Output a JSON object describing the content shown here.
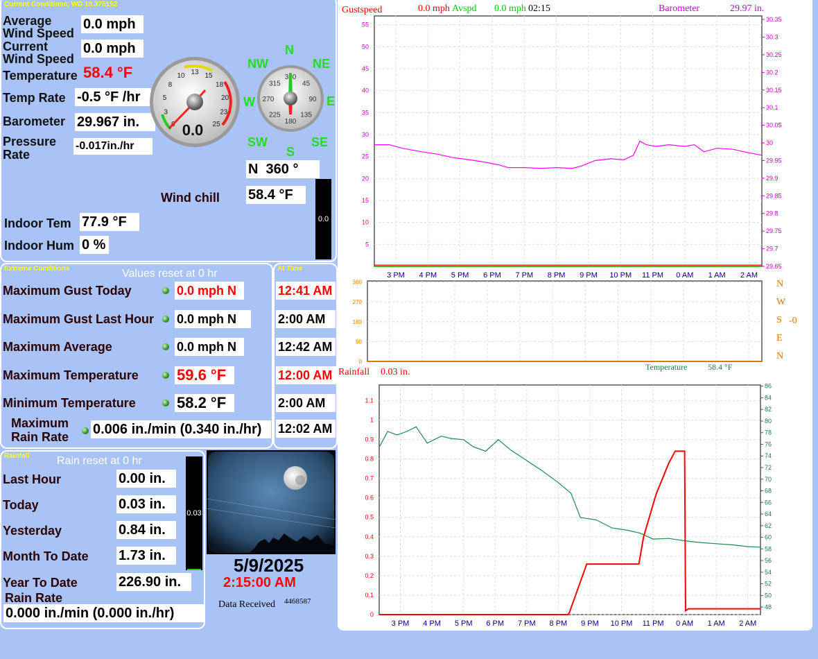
{
  "current": {
    "title": "Current Conditions, WD 10.375152",
    "avg_wind_label_1": "Average",
    "avg_wind_label_2": "Wind Speed",
    "avg_wind": "0.0 mph",
    "cur_wind_label_1": "Current",
    "cur_wind_label_2": "Wind Speed",
    "cur_wind": "0.0 mph",
    "temp_label": "Temperature",
    "temp": "58.4 °F",
    "temp_rate_label": "Temp Rate",
    "temp_rate": "-0.5 °F /hr",
    "baro_label": "Barometer",
    "baro": "29.967 in.",
    "press_rate_label_1": "Pressure",
    "press_rate_label_2": "Rate",
    "press_rate": "-0.017in./hr",
    "wind_chill_label": "Wind chill",
    "wind_chill": "58.4 °F",
    "indoor_temp_label": "Indoor Tem",
    "indoor_temp": "77.9 °F",
    "indoor_hum_label": "Indoor Hum",
    "indoor_hum": "0 %",
    "speed_gauge_value": "0.0",
    "speed_gauge_ticks": [
      "0",
      "3",
      "5",
      "8",
      "10",
      "13",
      "15",
      "18",
      "20",
      "23",
      "25"
    ],
    "dir_gauge_ticks": [
      "360",
      "45",
      "90",
      "135",
      "180",
      "225",
      "270",
      "315"
    ],
    "compass": {
      "n": "N",
      "ne": "NE",
      "e": "E",
      "se": "SE",
      "s": "S",
      "sw": "SW",
      "w": "W",
      "nw": "NW"
    },
    "wind_dir": "N  360 °",
    "side_bar_value": "0.0"
  },
  "extreme": {
    "title": "Extreme Conditions",
    "reset_note": "Values reset at 0 hr",
    "at_time_title": "At Time",
    "rows": [
      {
        "label": "Maximum Gust Today",
        "value": "0.0 mph N",
        "time": "12:41 AM"
      },
      {
        "label": "Maximum Gust Last Hour",
        "value": "0.0 mph  N",
        "time": "2:00 AM"
      },
      {
        "label": "Maximum Average",
        "value": "0.0 mph N",
        "time": "12:42 AM"
      },
      {
        "label": "Maximum Temperature",
        "value": "59.6 °F",
        "time": "12:00 AM"
      },
      {
        "label": "Minimum Temperature",
        "value": "58.2 °F",
        "time": "2:00 AM"
      }
    ],
    "rain_rate_label_1": "Maximum",
    "rain_rate_label_2": "Rain Rate",
    "rain_rate_value": "0.006 in./min (0.340 in./hr)",
    "rain_rate_time": "12:02 AM"
  },
  "rainfall": {
    "title": "Rainfall",
    "reset_note": "Rain reset at 0 hr",
    "rows": [
      {
        "label": "Last Hour",
        "value": "0.00 in."
      },
      {
        "label": "Today",
        "value": "0.03 in."
      },
      {
        "label": "Yesterday",
        "value": "0.84 in."
      },
      {
        "label": "Month To Date",
        "value": "1.73 in."
      },
      {
        "label": "Year To Date",
        "value": "226.90 in."
      }
    ],
    "rain_rate_label": "Rain Rate",
    "rain_rate": "0.000 in./min (0.000 in./hr)",
    "bar_value": "0.03"
  },
  "webcam": {
    "date": "5/9/2025",
    "time": "2:15:00 AM",
    "received_label": "Data Received",
    "received_count": "4468587"
  },
  "colors": {
    "bg": "#a9c3f7",
    "gust": "#ff0000",
    "avg": "#00cc00",
    "baro": "#ff00ff",
    "temp": "#1e8a4c",
    "rain": "#ff0000",
    "dir_axis": "#e07800"
  },
  "chart_data": [
    {
      "type": "line",
      "title": "",
      "legend": {
        "gust_label": "Gustspeed",
        "gust_value": "0.0 mph",
        "avg_label": "Avspd",
        "avg_value": "0.0 mph",
        "time": "02:15",
        "baro_label": "Barometer",
        "baro_value": "29.97 in."
      },
      "x": [
        "3 PM",
        "4 PM",
        "5 PM",
        "6 PM",
        "7 PM",
        "8 PM",
        "9 PM",
        "10 PM",
        "11 PM",
        "0 AM",
        "1 AM",
        "2 AM"
      ],
      "y_left_ticks": [
        5,
        10,
        15,
        20,
        25,
        30,
        35,
        40,
        45,
        50,
        55
      ],
      "y_left_range": [
        0,
        57
      ],
      "y_right_ticks": [
        "29.65",
        "29.7",
        "29.75",
        "29.8",
        "29.85",
        "29.9",
        "29.95",
        "30",
        "30.05",
        "30.1",
        "30.15",
        "30.2",
        "30.25",
        "30.3",
        "30.35"
      ],
      "y_right_range": [
        29.65,
        30.36
      ],
      "x_range": [
        2.33,
        14.4
      ],
      "series": [
        {
          "name": "Gustspeed",
          "axis": "left",
          "points": [
            [
              2.33,
              0.3
            ],
            [
              14.4,
              0.3
            ]
          ]
        },
        {
          "name": "Avspd",
          "axis": "left",
          "points": [
            [
              2.33,
              0
            ],
            [
              14.4,
              0
            ]
          ]
        },
        {
          "name": "Barometer",
          "axis": "right",
          "points": [
            [
              2.33,
              29.995
            ],
            [
              2.8,
              29.995
            ],
            [
              3.2,
              29.985
            ],
            [
              3.8,
              29.975
            ],
            [
              4.3,
              29.968
            ],
            [
              4.8,
              29.958
            ],
            [
              5.3,
              29.952
            ],
            [
              5.8,
              29.945
            ],
            [
              6.2,
              29.938
            ],
            [
              6.5,
              29.93
            ],
            [
              7,
              29.93
            ],
            [
              7.5,
              29.928
            ],
            [
              8,
              29.93
            ],
            [
              8.5,
              29.928
            ],
            [
              8.8,
              29.935
            ],
            [
              9.2,
              29.95
            ],
            [
              9.7,
              29.955
            ],
            [
              10.1,
              29.952
            ],
            [
              10.4,
              29.965
            ],
            [
              10.6,
              30.005
            ],
            [
              10.8,
              29.995
            ],
            [
              11.1,
              29.99
            ],
            [
              11.5,
              29.995
            ],
            [
              12,
              29.99
            ],
            [
              12.3,
              29.995
            ],
            [
              12.6,
              29.975
            ],
            [
              13,
              29.985
            ],
            [
              13.5,
              29.982
            ],
            [
              14,
              29.972
            ],
            [
              14.4,
              29.965
            ]
          ]
        }
      ]
    },
    {
      "type": "line",
      "title": "",
      "x": [
        "3 PM",
        "4 PM",
        "5 PM",
        "6 PM",
        "7 PM",
        "8 PM",
        "9 PM",
        "10 PM",
        "11 PM",
        "0 AM",
        "1 AM",
        "2 AM"
      ],
      "y_ticks": [
        0,
        90,
        180,
        270,
        360
      ],
      "y_range": [
        0,
        365
      ],
      "right_labels": [
        "N",
        "W",
        "S",
        "E",
        "N"
      ],
      "right_value": "-0",
      "series": [
        {
          "name": "Wind direction",
          "points": [
            [
              2.33,
              0
            ],
            [
              14.4,
              0
            ]
          ]
        }
      ]
    },
    {
      "type": "line",
      "title": "",
      "legend": {
        "rain_label": "Rainfall",
        "rain_value": "0.03 in.",
        "temp_label": "Temperature",
        "temp_value": "58.4 °F"
      },
      "x": [
        "3 PM",
        "4 PM",
        "5 PM",
        "6 PM",
        "7 PM",
        "8 PM",
        "9 PM",
        "10 PM",
        "11 PM",
        "0 AM",
        "1 AM",
        "2 AM"
      ],
      "y_left_ticks": [
        "0",
        "0.1",
        "0.2",
        "0.3",
        "0.4",
        "0.5",
        "0.6",
        "0.7",
        "0.8",
        "0.9",
        "1",
        "1.1"
      ],
      "y_left_range": [
        0,
        1.18
      ],
      "y_right_ticks": [
        48,
        50,
        52,
        54,
        56,
        58,
        60,
        62,
        64,
        66,
        68,
        70,
        72,
        74,
        76,
        78,
        80,
        82,
        84,
        86
      ],
      "y_right_range": [
        46.7,
        86.2
      ],
      "x_range": [
        2.33,
        14.4
      ],
      "series": [
        {
          "name": "Rainfall",
          "axis": "left",
          "points": [
            [
              2.33,
              0
            ],
            [
              8.3,
              0
            ],
            [
              8.35,
              0.01
            ],
            [
              8.9,
              0.26
            ],
            [
              10.55,
              0.26
            ],
            [
              10.7,
              0.4
            ],
            [
              11.1,
              0.62
            ],
            [
              11.5,
              0.78
            ],
            [
              11.7,
              0.84
            ],
            [
              12.0,
              0.84
            ],
            [
              12.03,
              0.02
            ],
            [
              12.12,
              0.03
            ],
            [
              14.4,
              0.03
            ]
          ]
        },
        {
          "name": "Temperature",
          "axis": "right",
          "points": [
            [
              2.33,
              75.5
            ],
            [
              2.6,
              78.2
            ],
            [
              2.9,
              77.6
            ],
            [
              3.2,
              78.2
            ],
            [
              3.5,
              79.0
            ],
            [
              3.65,
              77.8
            ],
            [
              3.85,
              76.2
            ],
            [
              4.3,
              77.4
            ],
            [
              4.6,
              77.0
            ],
            [
              5.0,
              76.8
            ],
            [
              5.3,
              75.6
            ],
            [
              5.7,
              74.8
            ],
            [
              6.1,
              76.8
            ],
            [
              6.5,
              75.0
            ],
            [
              7.0,
              73.2
            ],
            [
              7.5,
              71.4
            ],
            [
              8.0,
              69.4
            ],
            [
              8.4,
              67.6
            ],
            [
              8.7,
              63.4
            ],
            [
              9.2,
              63.0
            ],
            [
              9.7,
              61.6
            ],
            [
              10.2,
              61.2
            ],
            [
              10.6,
              60.7
            ],
            [
              11.0,
              59.7
            ],
            [
              11.5,
              59.8
            ],
            [
              12.0,
              59.4
            ],
            [
              12.5,
              59.1
            ],
            [
              13.0,
              58.9
            ],
            [
              13.5,
              58.7
            ],
            [
              14.0,
              58.4
            ],
            [
              14.4,
              58.3
            ]
          ]
        }
      ]
    }
  ]
}
